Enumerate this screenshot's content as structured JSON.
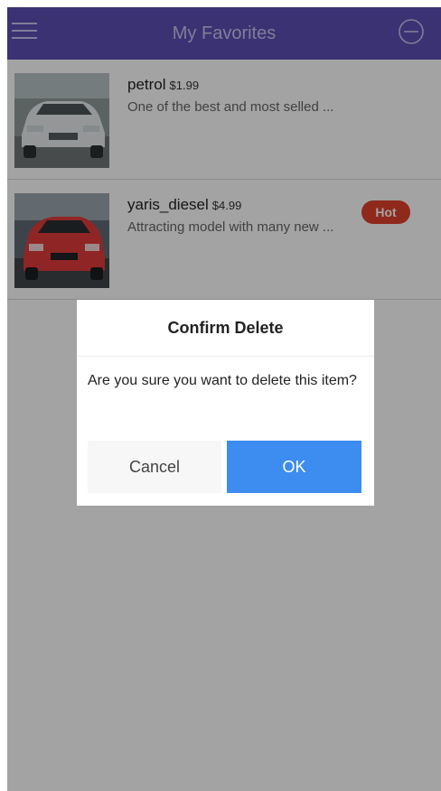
{
  "header": {
    "title": "My Favorites",
    "menu_icon": "hamburger-menu-icon",
    "action_icon": "minus-circle-icon",
    "color": "#5b4fb5"
  },
  "items": [
    {
      "name": "petrol",
      "price": "$1.99",
      "description": "One of the best and most selled ...",
      "image": "white sedan car photo",
      "badge": ""
    },
    {
      "name": "yaris_diesel",
      "price": "$4.99",
      "description": "Attracting model with many new ...",
      "image": "red hatchback car photo",
      "badge": "Hot"
    }
  ],
  "dialog": {
    "title": "Confirm Delete",
    "message": "Are you sure you want to delete this item?",
    "cancel_label": "Cancel",
    "ok_label": "OK",
    "ok_color": "#3d8cf0"
  },
  "colors": {
    "badge": "#e0412d"
  }
}
